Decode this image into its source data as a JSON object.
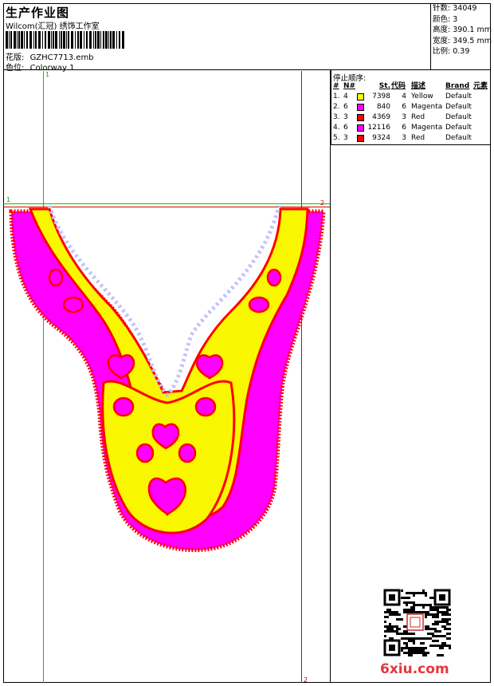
{
  "header": {
    "title": "生产作业图",
    "company": "Wilcom(汇冠) 绣饰工作室",
    "design_label": "花版:",
    "design_file": "GZHC7713.emb",
    "colorway_label": "色位:",
    "colorway": "Colorway 1"
  },
  "stats": [
    {
      "label": "针数:",
      "value": "34049"
    },
    {
      "label": "颜色:",
      "value": "3"
    },
    {
      "label": "高度:",
      "value": "390.1 mm"
    },
    {
      "label": "宽度:",
      "value": "349.5 mm"
    },
    {
      "label": "比例:",
      "value": "0.39"
    }
  ],
  "stop_sequence": {
    "title": "停止顺序:",
    "headers": [
      "#",
      "N#",
      "St.",
      "代码",
      "描述",
      "Brand",
      "元素"
    ],
    "rows": [
      {
        "no": "1.",
        "needle": "4",
        "stitches": "7398",
        "code": "4",
        "desc": "Yellow",
        "brand": "Default",
        "color": "#ffff00"
      },
      {
        "no": "2.",
        "needle": "6",
        "stitches": "840",
        "code": "6",
        "desc": "Magenta",
        "brand": "Default",
        "color": "#ff00ff"
      },
      {
        "no": "3.",
        "needle": "3",
        "stitches": "4369",
        "code": "3",
        "desc": "Red",
        "brand": "Default",
        "color": "#ff0000"
      },
      {
        "no": "4.",
        "needle": "6",
        "stitches": "12116",
        "code": "6",
        "desc": "Magenta",
        "brand": "Default",
        "color": "#ff00ff"
      },
      {
        "no": "5.",
        "needle": "3",
        "stitches": "9324",
        "code": "3",
        "desc": "Red",
        "brand": "Default",
        "color": "#ff0000"
      }
    ]
  },
  "guides": {
    "v1": "1",
    "h1_left": "1",
    "h1_right": "2",
    "v2": "2"
  },
  "watermark": "6xiu.com",
  "colors": {
    "yellow": "#ffff00",
    "magenta": "#ff00ff",
    "red": "#ff0000",
    "guide_green": "#00cc00",
    "guide_red": "#e00000"
  }
}
